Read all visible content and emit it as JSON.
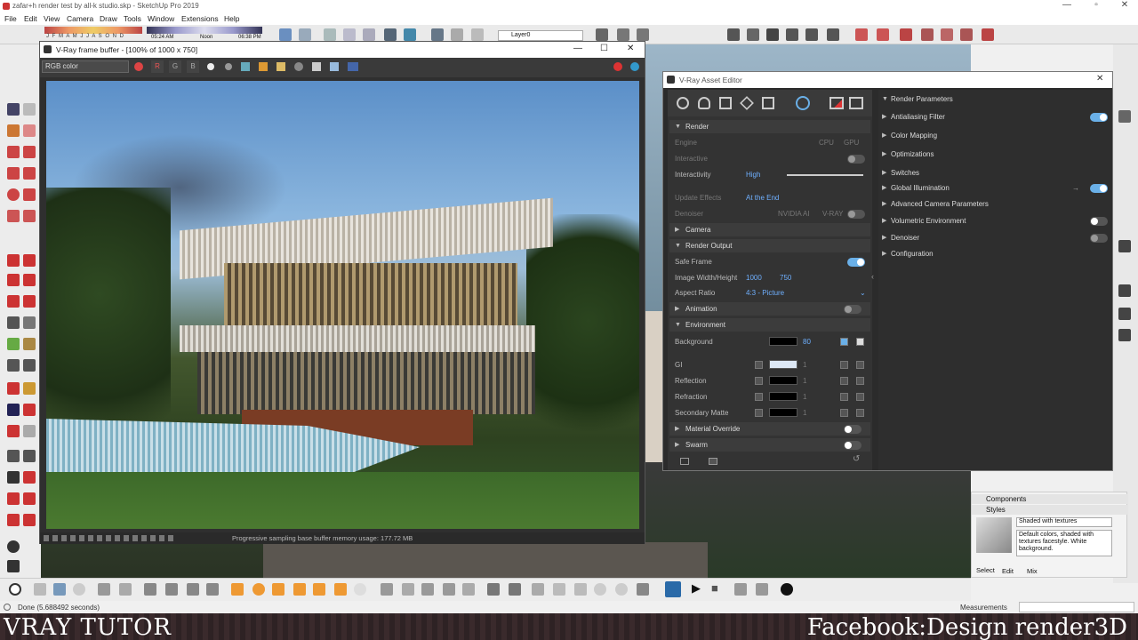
{
  "window": {
    "title": "zafar+h render test by all-k studio.skp - SketchUp Pro 2019"
  },
  "menu": [
    "File",
    "Edit",
    "View",
    "Camera",
    "Draw",
    "Tools",
    "Window",
    "Extensions",
    "Help"
  ],
  "toolbar": {
    "shadow_months": "J F M A M J J A S O N D",
    "time_left": "05:24 AM",
    "noon": "Noon",
    "time_right": "06:38 PM",
    "layer": "Layer0"
  },
  "vfb": {
    "title": "V-Ray frame buffer - [100% of 1000 x 750]",
    "channel": "RGB color",
    "r": "R",
    "g": "G",
    "b": "B",
    "status": "Progressive sampling base buffer memory usage: 177.72 MB"
  },
  "asset_editor": {
    "title": "V-Ray Asset Editor",
    "render": {
      "label": "Render",
      "engine": "Engine",
      "cpu": "CPU",
      "gpu": "GPU",
      "interactive": "Interactive",
      "interactivity": "Interactivity",
      "interactivity_value": "High",
      "update_effects": "Update Effects",
      "update_value": "At the End",
      "denoiser": "Denoiser",
      "nvidia": "NVIDIA AI",
      "vray": "V-RAY"
    },
    "camera": "Camera",
    "render_output": {
      "label": "Render Output",
      "safe_frame": "Safe Frame",
      "image_wh": "Image Width/Height",
      "width": "1000",
      "height": "750",
      "aspect": "Aspect Ratio",
      "aspect_value": "4:3 - Picture"
    },
    "animation": "Animation",
    "environment": {
      "label": "Environment",
      "background": "Background",
      "bg_value": "80",
      "gi": "GI",
      "gi_value": "1",
      "reflection": "Reflection",
      "refl_value": "1",
      "refraction": "Refraction",
      "refr_value": "1",
      "secondary": "Secondary Matte",
      "sec_value": "1"
    },
    "material_override": "Material Override",
    "swarm": "Swarm",
    "right": [
      "Render Parameters",
      "Antialiasing Filter",
      "Color Mapping",
      "Optimizations",
      "Switches",
      "Global Illumination",
      "Advanced Camera Parameters",
      "Volumetric Environment",
      "Denoiser",
      "Configuration"
    ]
  },
  "tray": {
    "components": "Components",
    "styles": "Styles",
    "style_name": "Shaded with textures",
    "style_desc": "Default colors, shaded with textures facestyle. White background.",
    "tabs": [
      "Select",
      "Edit",
      "Mix"
    ]
  },
  "status": {
    "left": "Done (5.688492 seconds)",
    "measurements": "Measurements"
  },
  "banner": {
    "left": "VRAY TUTOR",
    "right": "Facebook:Design render3D"
  }
}
